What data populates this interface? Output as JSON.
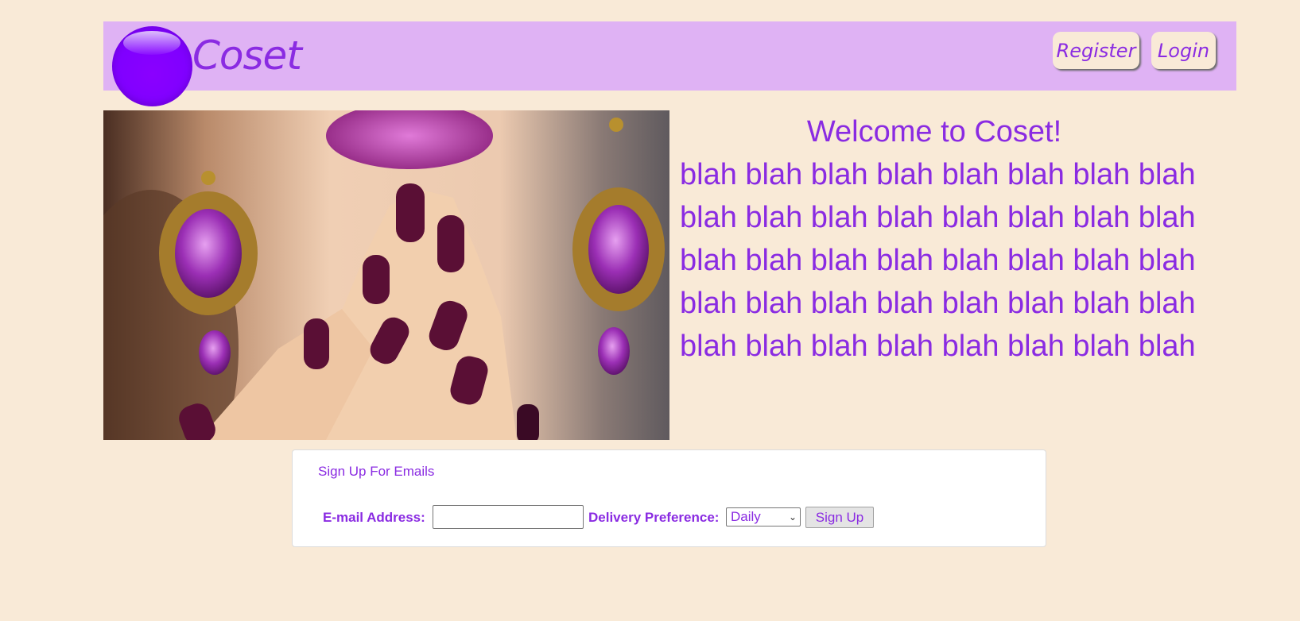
{
  "header": {
    "brand": "Coset",
    "register_label": "Register",
    "login_label": "Login"
  },
  "hero": {
    "image_icon": "model-with-jewelry-image"
  },
  "welcome": {
    "title": "Welcome to Coset!",
    "body": "blah blah blah blah blah blah blah blah blah blah blah blah blah blah blah blah blah blah blah blah blah blah blah blah blah blah blah blah blah blah blah blah blah blah blah blah blah blah blah blah"
  },
  "signup": {
    "title": "Sign Up For Emails",
    "email_label": "E-mail Address:",
    "email_value": "",
    "delivery_label": "Delivery Preference:",
    "delivery_selected": "Daily",
    "submit_label": "Sign Up"
  },
  "colors": {
    "page_background": "#f9ead7",
    "header_background": "#dfb2f4",
    "accent_purple": "#8a2be2",
    "logo_purple": "#8000ff"
  }
}
